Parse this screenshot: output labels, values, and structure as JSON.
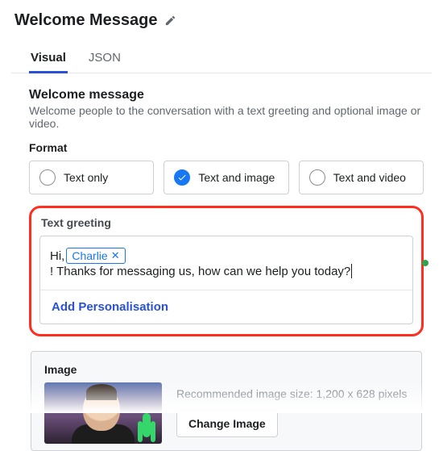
{
  "header": {
    "title": "Welcome Message"
  },
  "tabs": [
    {
      "label": "Visual",
      "active": true
    },
    {
      "label": "JSON",
      "active": false
    }
  ],
  "welcome": {
    "heading": "Welcome message",
    "subtext": "Welcome people to the conversation with a text greeting and optional image or video.",
    "format_label": "Format",
    "format_options": [
      {
        "label": "Text only",
        "selected": false
      },
      {
        "label": "Text and image",
        "selected": true
      },
      {
        "label": "Text and video",
        "selected": false
      }
    ]
  },
  "greeting": {
    "label": "Text greeting",
    "prefix": "Hi, ",
    "chip": "Charlie",
    "suffix": "! Thanks for messaging us, how can we help you today?",
    "add_personalisation": "Add Personalisation"
  },
  "image": {
    "label": "Image",
    "recommendation": "Recommended image size: 1,200 x 628 pixels",
    "change_button": "Change Image"
  }
}
